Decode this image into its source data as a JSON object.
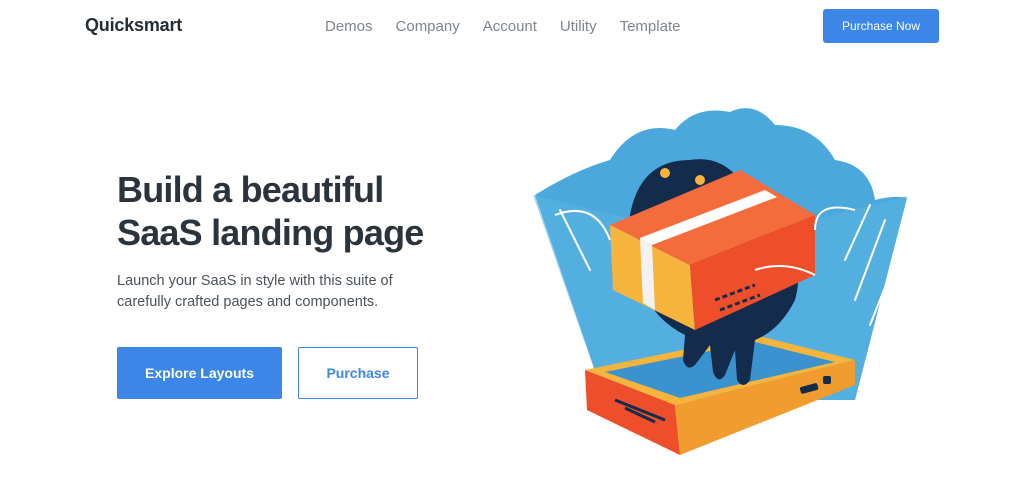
{
  "navbar": {
    "brand": "Quicksmart",
    "links": [
      "Demos",
      "Company",
      "Account",
      "Utility",
      "Template"
    ],
    "cta_label": "Purchase Now"
  },
  "hero": {
    "title_line1": "Build a beautiful",
    "title_line2": "SaaS landing page",
    "subtitle": "Launch your SaaS in style with this suite of carefully crafted pages and components.",
    "primary_button": "Explore Layouts",
    "secondary_button": "Purchase"
  },
  "illustration": {
    "icon": "hand-holding-package-over-phone-illustration"
  },
  "colors": {
    "accent": "#3b86e6",
    "heading": "#2b333c",
    "nav_text": "#7e858d",
    "illustration_blue": "#4aa8dd",
    "illustration_orange": "#ee4e2a",
    "illustration_yellow": "#f6b43c",
    "illustration_navy": "#132c4c"
  }
}
